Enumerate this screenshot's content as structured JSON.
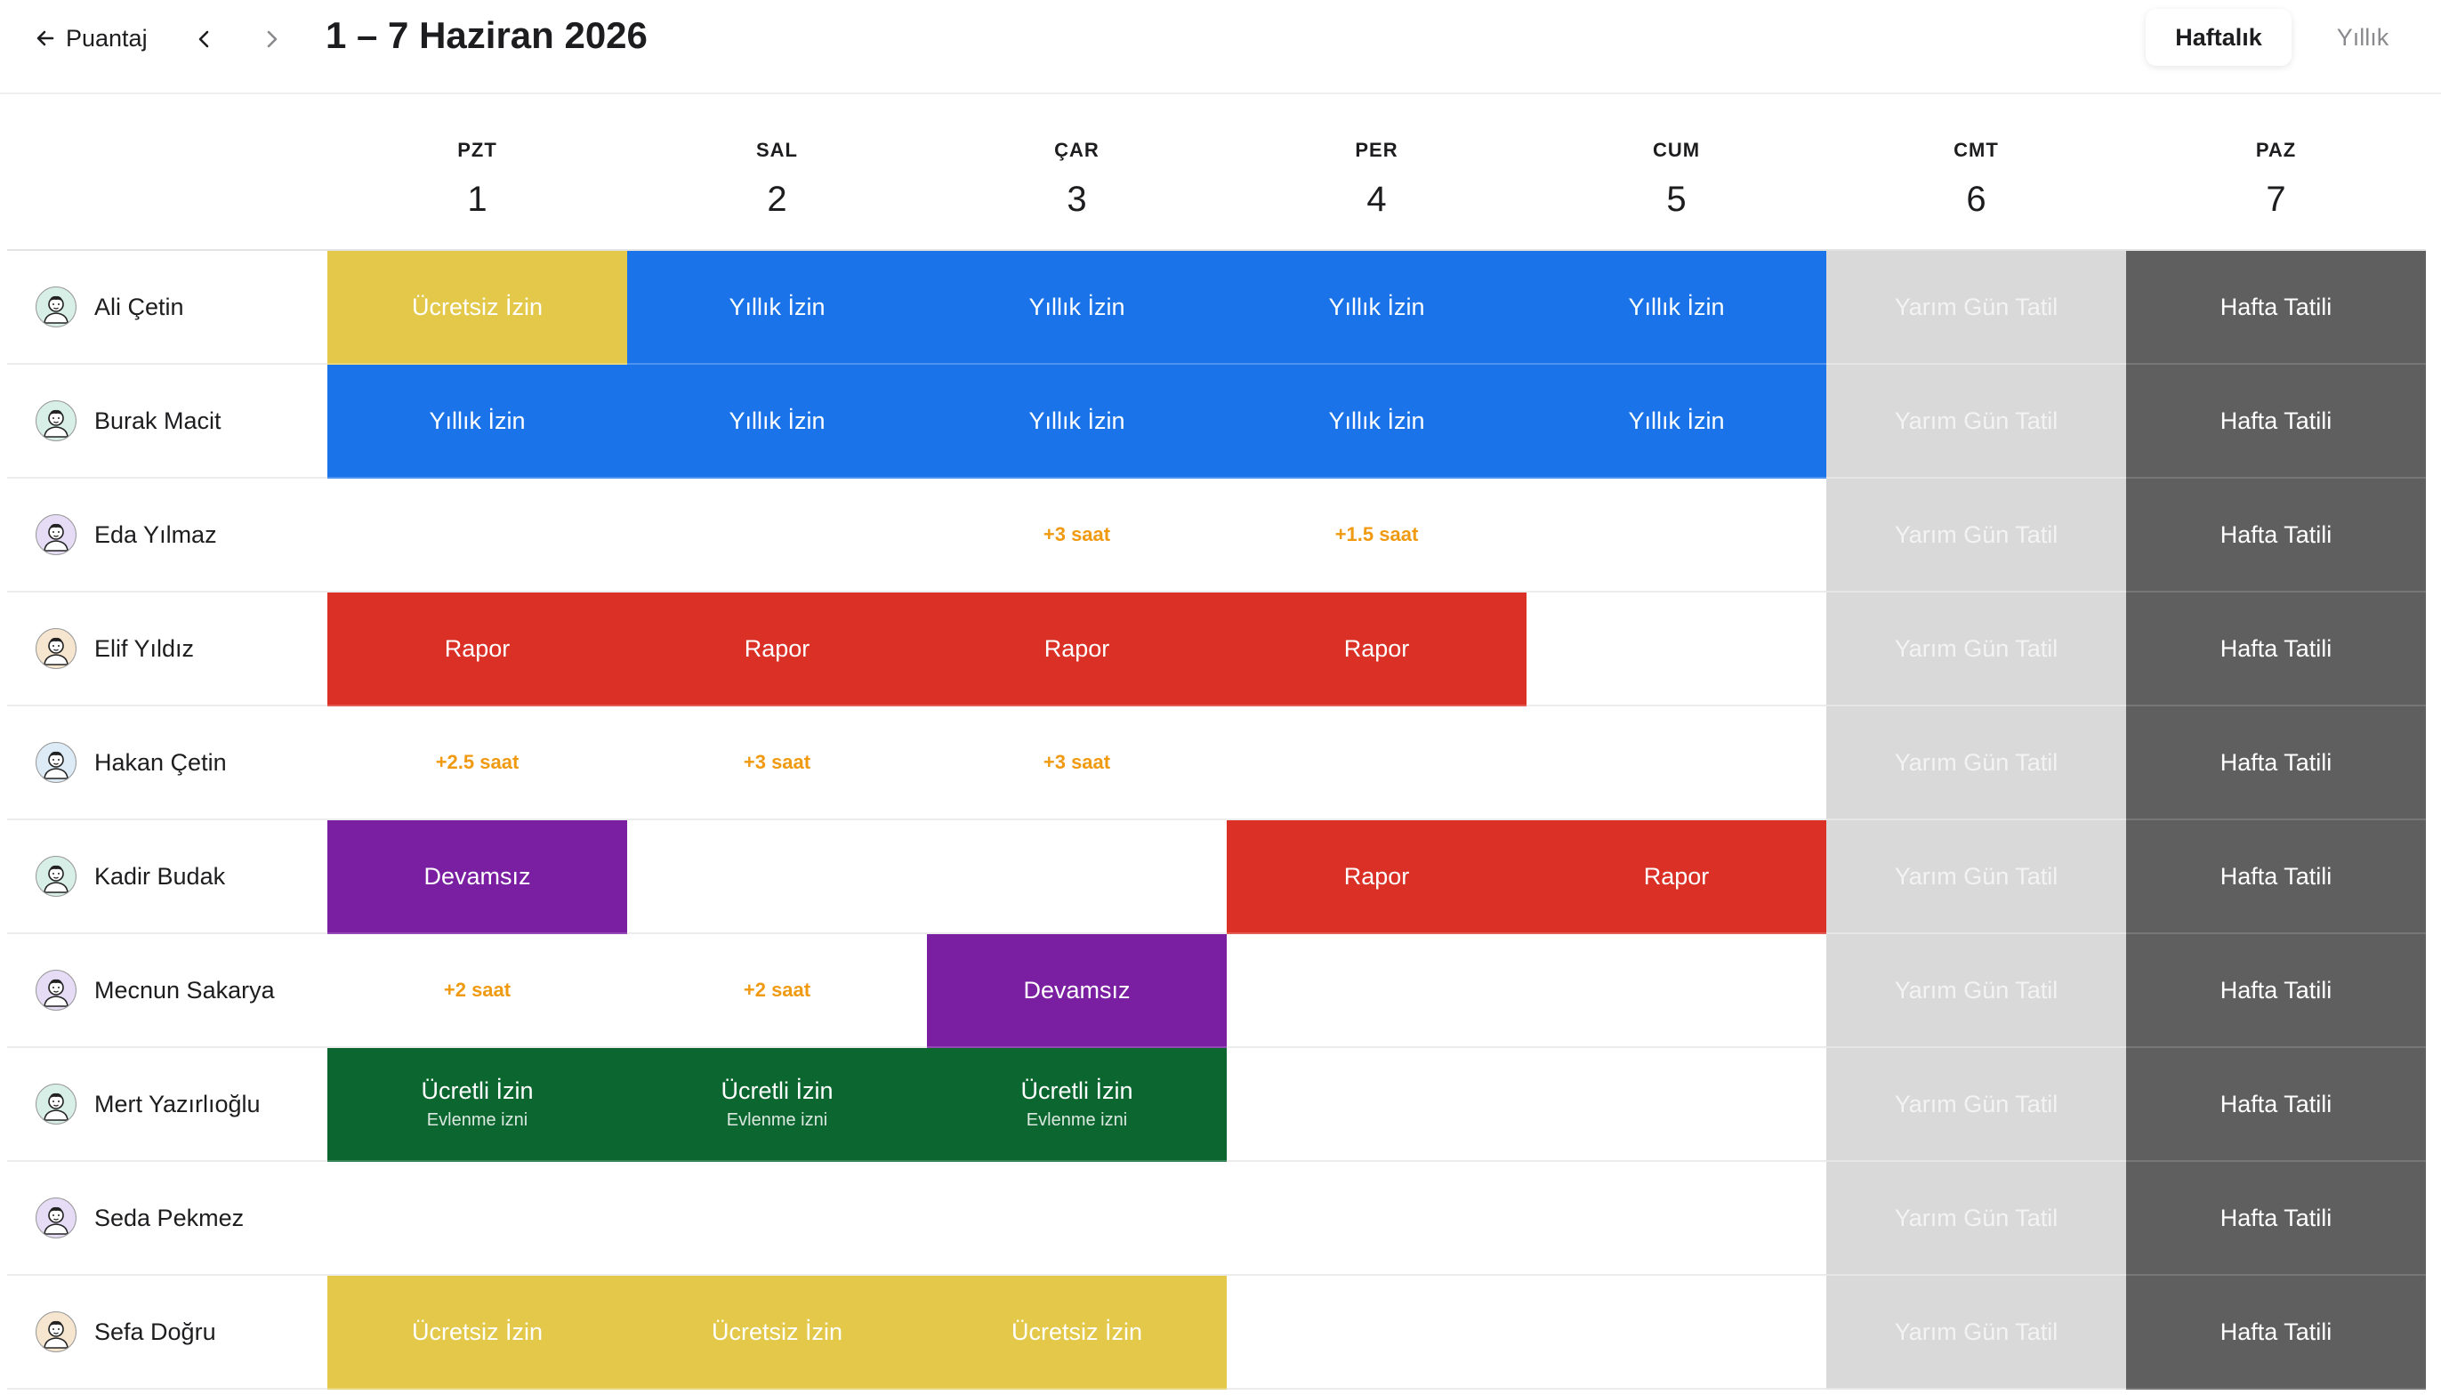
{
  "header": {
    "back_label": "Puantaj",
    "title": "1 – 7 Haziran 2026",
    "view_options": [
      "Haftalık",
      "Yıllık"
    ],
    "active_view": "Haftalık"
  },
  "days": [
    {
      "abbr": "PZT",
      "num": "1"
    },
    {
      "abbr": "SAL",
      "num": "2"
    },
    {
      "abbr": "ÇAR",
      "num": "3"
    },
    {
      "abbr": "PER",
      "num": "4"
    },
    {
      "abbr": "CUM",
      "num": "5"
    },
    {
      "abbr": "CMT",
      "num": "6"
    },
    {
      "abbr": "PAZ",
      "num": "7"
    }
  ],
  "colors": {
    "yillik": "#1a73e8",
    "ucretsiz": "#e3c84a",
    "rapor": "#da3025",
    "devamsiz": "#7b1fa2",
    "ucretli": "#0c6630",
    "yarim": "#d9d9d9",
    "hafta": "#5f5f5f",
    "mesai": "#f09a12"
  },
  "employees": [
    {
      "name": "Ali Çetin",
      "avatar": "person-avatar-icon",
      "avatar_bg": "#d7efe6",
      "cells": [
        {
          "type": "ucretsiz",
          "label": "Ücretsiz İzin"
        },
        {
          "type": "yillik",
          "label": "Yıllık İzin"
        },
        {
          "type": "yillik",
          "label": "Yıllık İzin"
        },
        {
          "type": "yillik",
          "label": "Yıllık İzin"
        },
        {
          "type": "yillik",
          "label": "Yıllık İzin"
        },
        {
          "type": "yarim",
          "label": "Yarım Gün Tatil"
        },
        {
          "type": "hafta",
          "label": "Hafta Tatili"
        }
      ]
    },
    {
      "name": "Burak Macit",
      "avatar": "person-avatar-icon",
      "avatar_bg": "#d7efe6",
      "cells": [
        {
          "type": "yillik",
          "label": "Yıllık İzin"
        },
        {
          "type": "yillik",
          "label": "Yıllık İzin"
        },
        {
          "type": "yillik",
          "label": "Yıllık İzin"
        },
        {
          "type": "yillik",
          "label": "Yıllık İzin"
        },
        {
          "type": "yillik",
          "label": "Yıllık İzin"
        },
        {
          "type": "yarim",
          "label": "Yarım Gün Tatil"
        },
        {
          "type": "hafta",
          "label": "Hafta Tatili"
        }
      ]
    },
    {
      "name": "Eda Yılmaz",
      "avatar": "person-avatar-icon",
      "avatar_bg": "#e6dcf6",
      "cells": [
        {
          "type": "empty",
          "label": ""
        },
        {
          "type": "empty",
          "label": ""
        },
        {
          "type": "mesai",
          "label": "+3 saat"
        },
        {
          "type": "mesai",
          "label": "+1.5 saat"
        },
        {
          "type": "empty",
          "label": ""
        },
        {
          "type": "yarim",
          "label": "Yarım Gün Tatil"
        },
        {
          "type": "hafta",
          "label": "Hafta Tatili"
        }
      ]
    },
    {
      "name": "Elif Yıldız",
      "avatar": "person-avatar-icon",
      "avatar_bg": "#f6e6cf",
      "cells": [
        {
          "type": "rapor",
          "label": "Rapor"
        },
        {
          "type": "rapor",
          "label": "Rapor"
        },
        {
          "type": "rapor",
          "label": "Rapor"
        },
        {
          "type": "rapor",
          "label": "Rapor"
        },
        {
          "type": "empty",
          "label": ""
        },
        {
          "type": "yarim",
          "label": "Yarım Gün Tatil"
        },
        {
          "type": "hafta",
          "label": "Hafta Tatili"
        }
      ]
    },
    {
      "name": "Hakan Çetin",
      "avatar": "person-avatar-icon",
      "avatar_bg": "#dcebf6",
      "cells": [
        {
          "type": "mesai",
          "label": "+2.5 saat"
        },
        {
          "type": "mesai",
          "label": "+3 saat"
        },
        {
          "type": "mesai",
          "label": "+3 saat"
        },
        {
          "type": "empty",
          "label": ""
        },
        {
          "type": "empty",
          "label": ""
        },
        {
          "type": "yarim",
          "label": "Yarım Gün Tatil"
        },
        {
          "type": "hafta",
          "label": "Hafta Tatili"
        }
      ]
    },
    {
      "name": "Kadir Budak",
      "avatar": "person-avatar-icon",
      "avatar_bg": "#d7efe6",
      "cells": [
        {
          "type": "devamsiz",
          "label": "Devamsız"
        },
        {
          "type": "empty",
          "label": ""
        },
        {
          "type": "empty",
          "label": ""
        },
        {
          "type": "rapor",
          "label": "Rapor"
        },
        {
          "type": "rapor",
          "label": "Rapor"
        },
        {
          "type": "yarim",
          "label": "Yarım Gün Tatil"
        },
        {
          "type": "hafta",
          "label": "Hafta Tatili"
        }
      ]
    },
    {
      "name": "Mecnun Sakarya",
      "avatar": "person-avatar-icon",
      "avatar_bg": "#e6dcf6",
      "cells": [
        {
          "type": "mesai",
          "label": "+2 saat"
        },
        {
          "type": "mesai",
          "label": "+2 saat"
        },
        {
          "type": "devamsiz",
          "label": "Devamsız"
        },
        {
          "type": "empty",
          "label": ""
        },
        {
          "type": "empty",
          "label": ""
        },
        {
          "type": "yarim",
          "label": "Yarım Gün Tatil"
        },
        {
          "type": "hafta",
          "label": "Hafta Tatili"
        }
      ]
    },
    {
      "name": "Mert Yazırlıoğlu",
      "avatar": "person-avatar-icon",
      "avatar_bg": "#d7efe6",
      "cells": [
        {
          "type": "ucretli",
          "label": "Ücretli İzin",
          "sub": "Evlenme izni"
        },
        {
          "type": "ucretli",
          "label": "Ücretli İzin",
          "sub": "Evlenme izni"
        },
        {
          "type": "ucretli",
          "label": "Ücretli İzin",
          "sub": "Evlenme izni"
        },
        {
          "type": "empty",
          "label": ""
        },
        {
          "type": "empty",
          "label": ""
        },
        {
          "type": "yarim",
          "label": "Yarım Gün Tatil"
        },
        {
          "type": "hafta",
          "label": "Hafta Tatili"
        }
      ]
    },
    {
      "name": "Seda Pekmez",
      "avatar": "person-avatar-icon",
      "avatar_bg": "#e6dcf6",
      "cells": [
        {
          "type": "empty",
          "label": ""
        },
        {
          "type": "empty",
          "label": ""
        },
        {
          "type": "empty",
          "label": ""
        },
        {
          "type": "empty",
          "label": ""
        },
        {
          "type": "empty",
          "label": ""
        },
        {
          "type": "yarim",
          "label": "Yarım Gün Tatil"
        },
        {
          "type": "hafta",
          "label": "Hafta Tatili"
        }
      ]
    },
    {
      "name": "Sefa Doğru",
      "avatar": "person-avatar-icon",
      "avatar_bg": "#f6e6cf",
      "cells": [
        {
          "type": "ucretsiz",
          "label": "Ücretsiz İzin"
        },
        {
          "type": "ucretsiz",
          "label": "Ücretsiz İzin"
        },
        {
          "type": "ucretsiz",
          "label": "Ücretsiz İzin"
        },
        {
          "type": "empty",
          "label": ""
        },
        {
          "type": "empty",
          "label": ""
        },
        {
          "type": "yarim",
          "label": "Yarım Gün Tatil"
        },
        {
          "type": "hafta",
          "label": "Hafta Tatili"
        }
      ]
    }
  ]
}
